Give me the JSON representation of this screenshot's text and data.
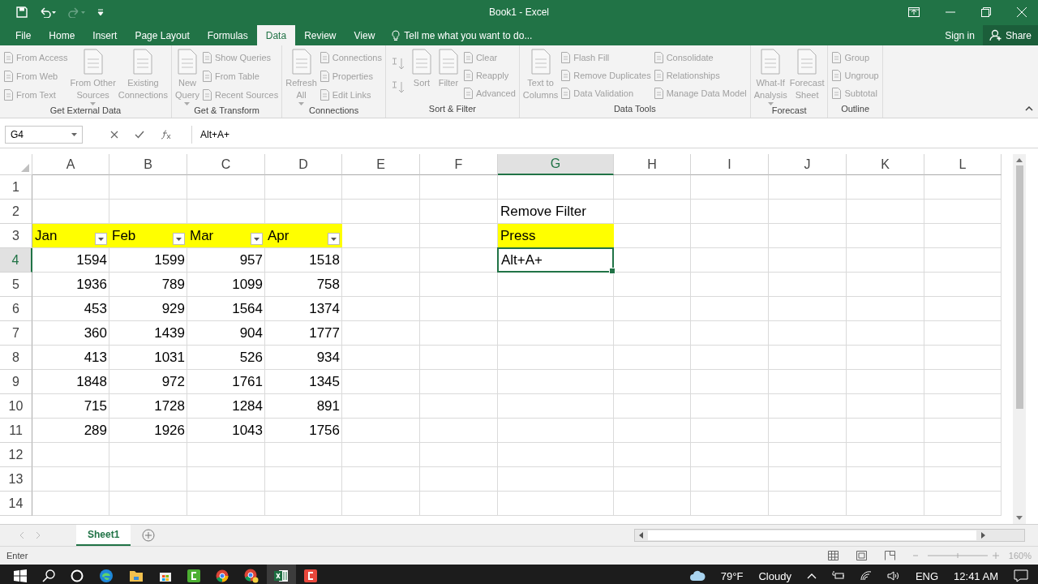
{
  "window": {
    "title": "Book1 - Excel"
  },
  "tabs": [
    {
      "label": "File",
      "selected": false
    },
    {
      "label": "Home",
      "selected": false
    },
    {
      "label": "Insert",
      "selected": false
    },
    {
      "label": "Page Layout",
      "selected": false
    },
    {
      "label": "Formulas",
      "selected": false
    },
    {
      "label": "Data",
      "selected": true
    },
    {
      "label": "Review",
      "selected": false
    },
    {
      "label": "View",
      "selected": false
    }
  ],
  "tell_me": {
    "placeholder": "Tell me what you want to do..."
  },
  "sign_in": "Sign in",
  "share": "Share",
  "ribbon": {
    "disabled": true,
    "groups": [
      {
        "label": "Get External Data",
        "columns": [
          {
            "kind": "stack",
            "items": [
              "From Access",
              "From Web",
              "From Text"
            ]
          },
          {
            "kind": "large",
            "label": "From Other\nSources",
            "menu": true
          },
          {
            "kind": "large",
            "label": "Existing\nConnections",
            "menu": false
          }
        ]
      },
      {
        "label": "Get & Transform",
        "columns": [
          {
            "kind": "large",
            "label": "New\nQuery",
            "menu": true
          },
          {
            "kind": "stack",
            "items": [
              "Show Queries",
              "From Table",
              "Recent Sources"
            ]
          }
        ]
      },
      {
        "label": "Connections",
        "columns": [
          {
            "kind": "large",
            "label": "Refresh\nAll",
            "menu": true
          },
          {
            "kind": "stack",
            "items": [
              "Connections",
              "Properties",
              "Edit Links"
            ]
          }
        ]
      },
      {
        "label": "Sort & Filter",
        "columns": [
          {
            "kind": "sortpair"
          },
          {
            "kind": "large",
            "label": "Sort",
            "menu": false
          },
          {
            "kind": "large",
            "label": "Filter",
            "menu": false
          },
          {
            "kind": "stack",
            "items": [
              "Clear",
              "Reapply",
              "Advanced"
            ]
          }
        ]
      },
      {
        "label": "Data Tools",
        "columns": [
          {
            "kind": "large",
            "label": "Text to\nColumns",
            "menu": false
          },
          {
            "kind": "stack",
            "items": [
              "Flash Fill",
              "Remove Duplicates",
              "Data Validation"
            ]
          },
          {
            "kind": "stack",
            "items": [
              "Consolidate",
              "Relationships",
              "Manage Data Model"
            ]
          }
        ]
      },
      {
        "label": "Forecast",
        "columns": [
          {
            "kind": "large",
            "label": "What-If\nAnalysis",
            "menu": true
          },
          {
            "kind": "large",
            "label": "Forecast\nSheet",
            "menu": false
          }
        ]
      },
      {
        "label": "Outline",
        "columns": [
          {
            "kind": "stack",
            "items": [
              "Group",
              "Ungroup",
              "Subtotal"
            ]
          }
        ]
      }
    ]
  },
  "formula_bar": {
    "name_box": "G4",
    "formula": "Alt+A+"
  },
  "sheet": {
    "columns": [
      {
        "label": "A",
        "selected": false
      },
      {
        "label": "B",
        "selected": false
      },
      {
        "label": "C",
        "selected": false
      },
      {
        "label": "D",
        "selected": false
      },
      {
        "label": "E",
        "selected": false
      },
      {
        "label": "F",
        "selected": false
      },
      {
        "label": "G",
        "selected": true
      },
      {
        "label": "H",
        "selected": false
      },
      {
        "label": "I",
        "selected": false
      },
      {
        "label": "J",
        "selected": false
      },
      {
        "label": "K",
        "selected": false
      },
      {
        "label": "L",
        "selected": false
      }
    ],
    "rows": [
      {
        "label": "1",
        "selected": false,
        "cells": []
      },
      {
        "label": "2",
        "selected": false,
        "cells": [
          null,
          null,
          null,
          null,
          null,
          null,
          {
            "text": "Remove Filter",
            "kind": "text"
          }
        ]
      },
      {
        "label": "3",
        "selected": false,
        "cells": [
          {
            "text": "Jan",
            "kind": "filter_header"
          },
          {
            "text": "Feb",
            "kind": "filter_header"
          },
          {
            "text": "Mar",
            "kind": "filter_header"
          },
          {
            "text": "Apr",
            "kind": "filter_header"
          },
          null,
          null,
          {
            "text": "Press",
            "kind": "highlight"
          }
        ]
      },
      {
        "label": "4",
        "selected": true,
        "cells": [
          {
            "text": "1594",
            "kind": "number"
          },
          {
            "text": "1599",
            "kind": "number"
          },
          {
            "text": "957",
            "kind": "number"
          },
          {
            "text": "1518",
            "kind": "number"
          },
          null,
          null,
          {
            "text": "Alt+A+",
            "kind": "text"
          }
        ]
      },
      {
        "label": "5",
        "selected": false,
        "cells": [
          {
            "text": "1936",
            "kind": "number"
          },
          {
            "text": "789",
            "kind": "number"
          },
          {
            "text": "1099",
            "kind": "number"
          },
          {
            "text": "758",
            "kind": "number"
          }
        ]
      },
      {
        "label": "6",
        "selected": false,
        "cells": [
          {
            "text": "453",
            "kind": "number"
          },
          {
            "text": "929",
            "kind": "number"
          },
          {
            "text": "1564",
            "kind": "number"
          },
          {
            "text": "1374",
            "kind": "number"
          }
        ]
      },
      {
        "label": "7",
        "selected": false,
        "cells": [
          {
            "text": "360",
            "kind": "number"
          },
          {
            "text": "1439",
            "kind": "number"
          },
          {
            "text": "904",
            "kind": "number"
          },
          {
            "text": "1777",
            "kind": "number"
          }
        ]
      },
      {
        "label": "8",
        "selected": false,
        "cells": [
          {
            "text": "413",
            "kind": "number"
          },
          {
            "text": "1031",
            "kind": "number"
          },
          {
            "text": "526",
            "kind": "number"
          },
          {
            "text": "934",
            "kind": "number"
          }
        ]
      },
      {
        "label": "9",
        "selected": false,
        "cells": [
          {
            "text": "1848",
            "kind": "number"
          },
          {
            "text": "972",
            "kind": "number"
          },
          {
            "text": "1761",
            "kind": "number"
          },
          {
            "text": "1345",
            "kind": "number"
          }
        ]
      },
      {
        "label": "10",
        "selected": false,
        "cells": [
          {
            "text": "715",
            "kind": "number"
          },
          {
            "text": "1728",
            "kind": "number"
          },
          {
            "text": "1284",
            "kind": "number"
          },
          {
            "text": "891",
            "kind": "number"
          }
        ]
      },
      {
        "label": "11",
        "selected": false,
        "cells": [
          {
            "text": "289",
            "kind": "number"
          },
          {
            "text": "1926",
            "kind": "number"
          },
          {
            "text": "1043",
            "kind": "number"
          },
          {
            "text": "1756",
            "kind": "number"
          }
        ]
      },
      {
        "label": "12",
        "selected": false,
        "cells": []
      },
      {
        "label": "13",
        "selected": false,
        "cells": []
      },
      {
        "label": "14",
        "selected": false,
        "cells": []
      }
    ]
  },
  "sheet_tabs": [
    {
      "label": "Sheet1",
      "selected": true
    }
  ],
  "status_bar": {
    "mode": "Enter",
    "zoom": "160%"
  },
  "taskbar": {
    "temperature": "79°F",
    "weather": "Cloudy",
    "language": "ENG",
    "time": "12:41 AM"
  }
}
